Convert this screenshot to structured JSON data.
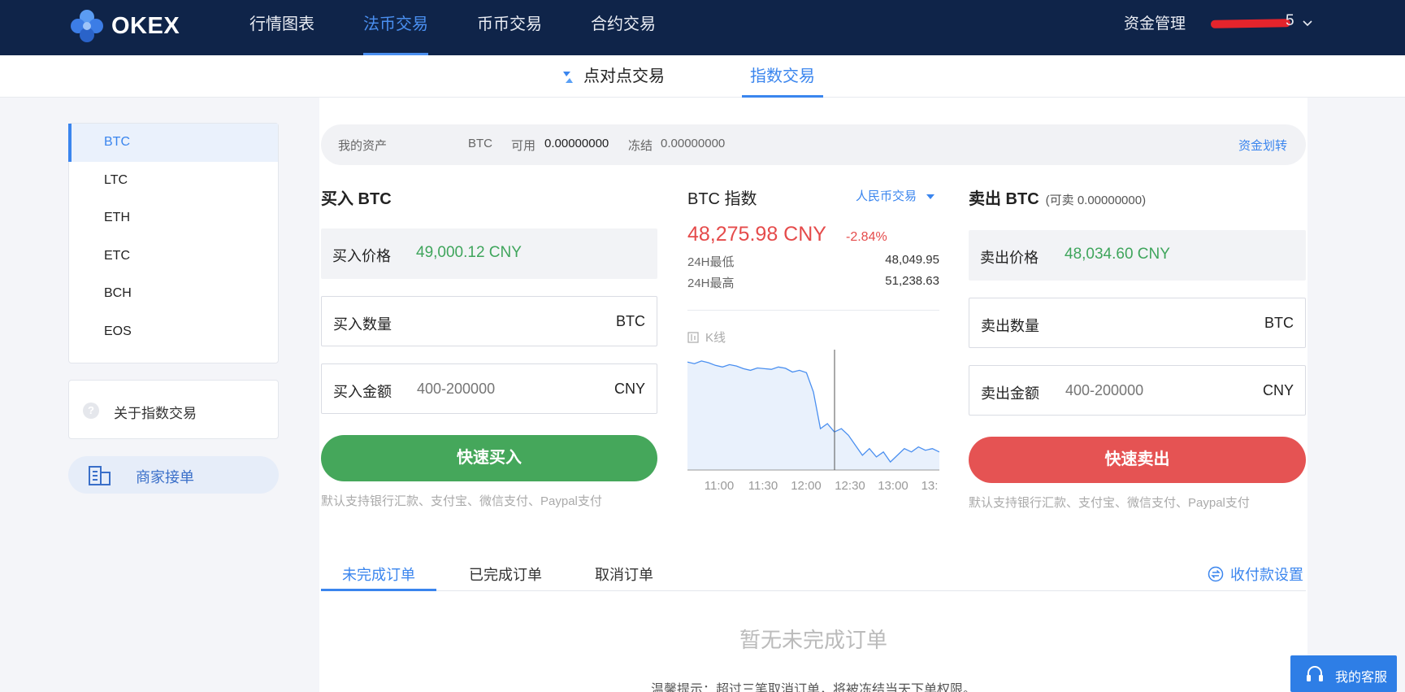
{
  "brand": {
    "name": "OKEX"
  },
  "topnav": {
    "items": [
      "行情图表",
      "法币交易",
      "币币交易",
      "合约交易"
    ],
    "fund_management": "资金管理",
    "user_tail": "5"
  },
  "subnav": {
    "p2p": "点对点交易",
    "index": "指数交易"
  },
  "sidebar": {
    "coins": [
      "BTC",
      "LTC",
      "ETH",
      "ETC",
      "BCH",
      "EOS"
    ],
    "about": "关于指数交易",
    "merchant": "商家接单"
  },
  "assets": {
    "label": "我的资产",
    "coin": "BTC",
    "available_label": "可用",
    "available_value": "0.00000000",
    "frozen_label": "冻结",
    "frozen_value": "0.00000000",
    "transfer": "资金划转"
  },
  "buy": {
    "title": "买入 BTC",
    "price_label": "买入价格",
    "price_value": "49,000.12 CNY",
    "qty_label": "买入数量",
    "qty_unit": "BTC",
    "amount_label": "买入金额",
    "amount_placeholder": "400-200000",
    "amount_unit": "CNY",
    "button": "快速买入",
    "note": "默认支持银行汇款、支付宝、微信支付、Paypal支付"
  },
  "index": {
    "title": "BTC 指数",
    "dropdown": "人民币交易",
    "price": "48,275.98 CNY",
    "change": "-2.84%",
    "low_label": "24H最低",
    "low_value": "48,049.95",
    "high_label": "24H最高",
    "high_value": "51,238.63",
    "kline_label": "K线"
  },
  "sell": {
    "title": "卖出 BTC",
    "subtitle": "(可卖 0.00000000)",
    "price_label": "卖出价格",
    "price_value": "48,034.60 CNY",
    "qty_label": "卖出数量",
    "qty_unit": "BTC",
    "amount_label": "卖出金额",
    "amount_placeholder": "400-200000",
    "amount_unit": "CNY",
    "button": "快速卖出",
    "note": "默认支持银行汇款、支付宝、微信支付、Paypal支付"
  },
  "orders": {
    "tabs": [
      "未完成订单",
      "已完成订单",
      "取消订单"
    ],
    "pay_setting": "收付款设置",
    "empty": "暂无未完成订单",
    "tip": "温馨提示：超过三笔取消订单，将被冻结当天下单权限。"
  },
  "service": {
    "label": "我的客服"
  },
  "chart_data": {
    "type": "area",
    "x_ticks": [
      "11:00",
      "11:30",
      "12:00",
      "12:30",
      "13:00",
      "13:"
    ],
    "y": [
      51200,
      51150,
      51230,
      51180,
      51100,
      51050,
      51120,
      51080,
      51000,
      50950,
      51020,
      51000,
      50980,
      51050,
      51010,
      50900,
      50950,
      50880,
      50300,
      49200,
      49350,
      49100,
      49200,
      49000,
      48700,
      48400,
      48600,
      48350,
      48500,
      48200,
      48400,
      48600,
      48500,
      48650,
      48550,
      48600,
      48500
    ],
    "colors": {
      "line": "#4a8ff0",
      "fill": "#e9f1fc"
    }
  }
}
